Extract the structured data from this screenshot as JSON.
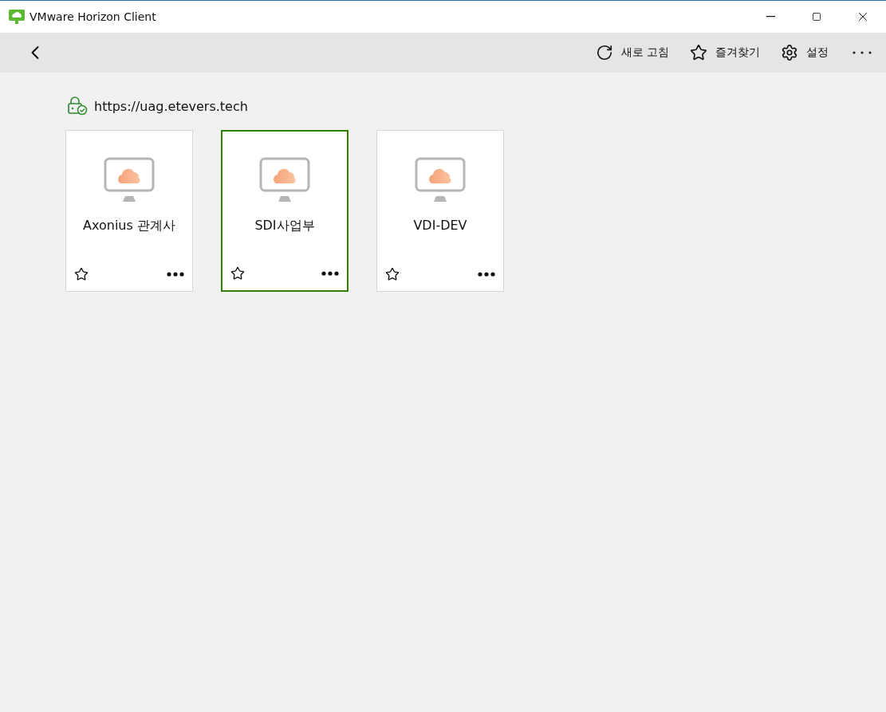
{
  "window": {
    "title": "VMware Horizon Client"
  },
  "toolbar": {
    "actions": [
      {
        "kind": "refresh",
        "label": "새로 고침"
      },
      {
        "kind": "favorites",
        "label": "즐겨찾기"
      },
      {
        "kind": "settings",
        "label": "설정"
      }
    ]
  },
  "server": {
    "url": "https://uag.etevers.tech"
  },
  "desktops": [
    {
      "name": "Axonius 관계사",
      "selected": false,
      "favorite": false
    },
    {
      "name": "SDI사업부",
      "selected": true,
      "favorite": false
    },
    {
      "name": "VDI-DEV",
      "selected": false,
      "favorite": false
    }
  ]
}
